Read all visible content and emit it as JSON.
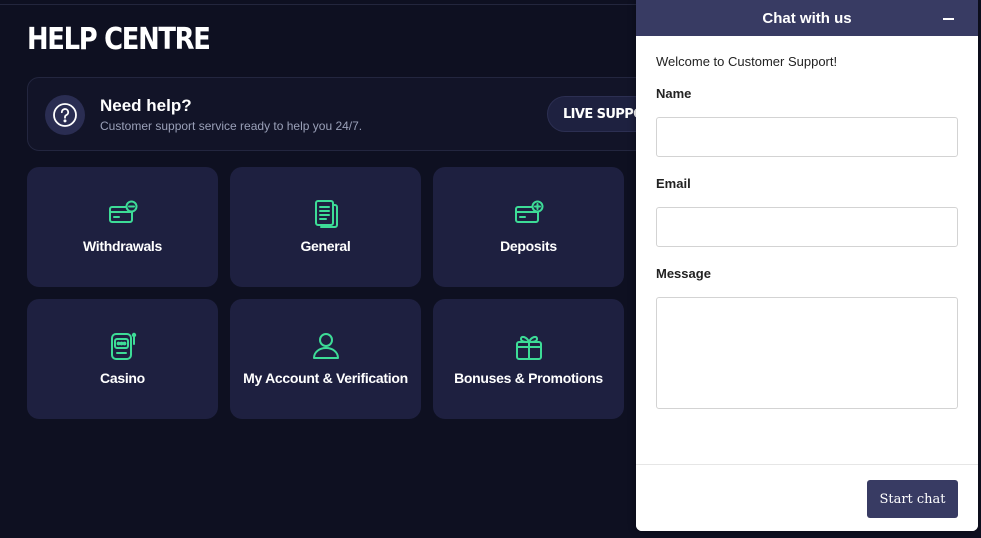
{
  "page": {
    "title": "HELP CENTRE"
  },
  "help_banner": {
    "title": "Need help?",
    "subtitle": "Customer support service ready to help you 24/7.",
    "live_support_label": "LIVE SUPPORT"
  },
  "categories": [
    {
      "label": "Withdrawals",
      "icon": "card-minus-icon"
    },
    {
      "label": "General",
      "icon": "document-icon"
    },
    {
      "label": "Deposits",
      "icon": "card-plus-icon"
    },
    {
      "label": "Casino",
      "icon": "slot-machine-icon"
    },
    {
      "label": "My Account & Verification",
      "icon": "user-icon"
    },
    {
      "label": "Bonuses & Promotions",
      "icon": "gift-icon"
    }
  ],
  "chat": {
    "title": "Chat with us",
    "welcome": "Welcome to Customer Support!",
    "name_label": "Name",
    "email_label": "Email",
    "message_label": "Message",
    "name_value": "",
    "email_value": "",
    "message_value": "",
    "start_label": "Start chat"
  },
  "colors": {
    "background": "#0e1021",
    "card": "#1e2040",
    "accent_green": "#3ddc97",
    "chat_header": "#383b63"
  }
}
